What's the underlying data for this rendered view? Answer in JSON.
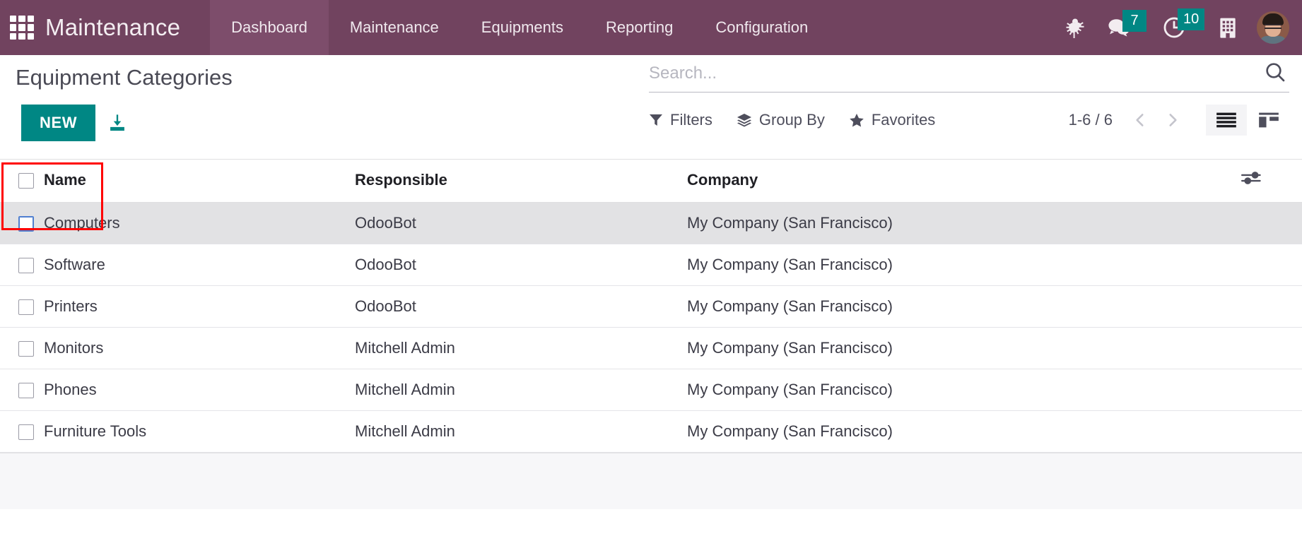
{
  "navbar": {
    "apps_icon": "apps-grid-icon",
    "brand": "Maintenance",
    "menu": [
      {
        "label": "Dashboard",
        "active": true
      },
      {
        "label": "Maintenance",
        "active": false
      },
      {
        "label": "Equipments",
        "active": false
      },
      {
        "label": "Reporting",
        "active": false
      },
      {
        "label": "Configuration",
        "active": false
      }
    ],
    "icons": {
      "debug": "bug-icon",
      "messages": "chat-bubbles-icon",
      "messages_count": "7",
      "activities": "clock-icon",
      "activities_count": "10",
      "company": "building-icon",
      "user": "avatar"
    },
    "accent_purple": "#71435f",
    "accent_purple_active": "#7d4d6b",
    "badge_color": "#008784"
  },
  "control_panel": {
    "title": "Equipment Categories",
    "new_label": "NEW",
    "new_button_color": "#008784",
    "import_icon": "import-download-icon",
    "highlight_color": "#ff0000"
  },
  "search": {
    "placeholder": "Search...",
    "value": "",
    "search_icon": "search-icon"
  },
  "toolbar": {
    "filters_label": "Filters",
    "filters_icon": "filter-funnel-icon",
    "group_by_label": "Group By",
    "group_by_icon": "layers-icon",
    "favorites_label": "Favorites",
    "favorites_icon": "star-icon",
    "pager_text": "1-6 / 6",
    "prev_icon": "chevron-left-icon",
    "next_icon": "chevron-right-icon",
    "list_view_icon": "list-view-icon",
    "kanban_view_icon": "kanban-view-icon",
    "active_view": "list"
  },
  "table": {
    "columns": [
      "Name",
      "Responsible",
      "Company"
    ],
    "optional_columns_icon": "sliders-icon",
    "select_all_checkbox": false,
    "rows": [
      {
        "name": "Computers",
        "responsible": "OdooBot",
        "company": "My Company (San Francisco)",
        "hovered": true
      },
      {
        "name": "Software",
        "responsible": "OdooBot",
        "company": "My Company (San Francisco)",
        "hovered": false
      },
      {
        "name": "Printers",
        "responsible": "OdooBot",
        "company": "My Company (San Francisco)",
        "hovered": false
      },
      {
        "name": "Monitors",
        "responsible": "Mitchell Admin",
        "company": "My Company (San Francisco)",
        "hovered": false
      },
      {
        "name": "Phones",
        "responsible": "Mitchell Admin",
        "company": "My Company (San Francisco)",
        "hovered": false
      },
      {
        "name": "Furniture Tools",
        "responsible": "Mitchell Admin",
        "company": "My Company (San Francisco)",
        "hovered": false
      }
    ]
  }
}
